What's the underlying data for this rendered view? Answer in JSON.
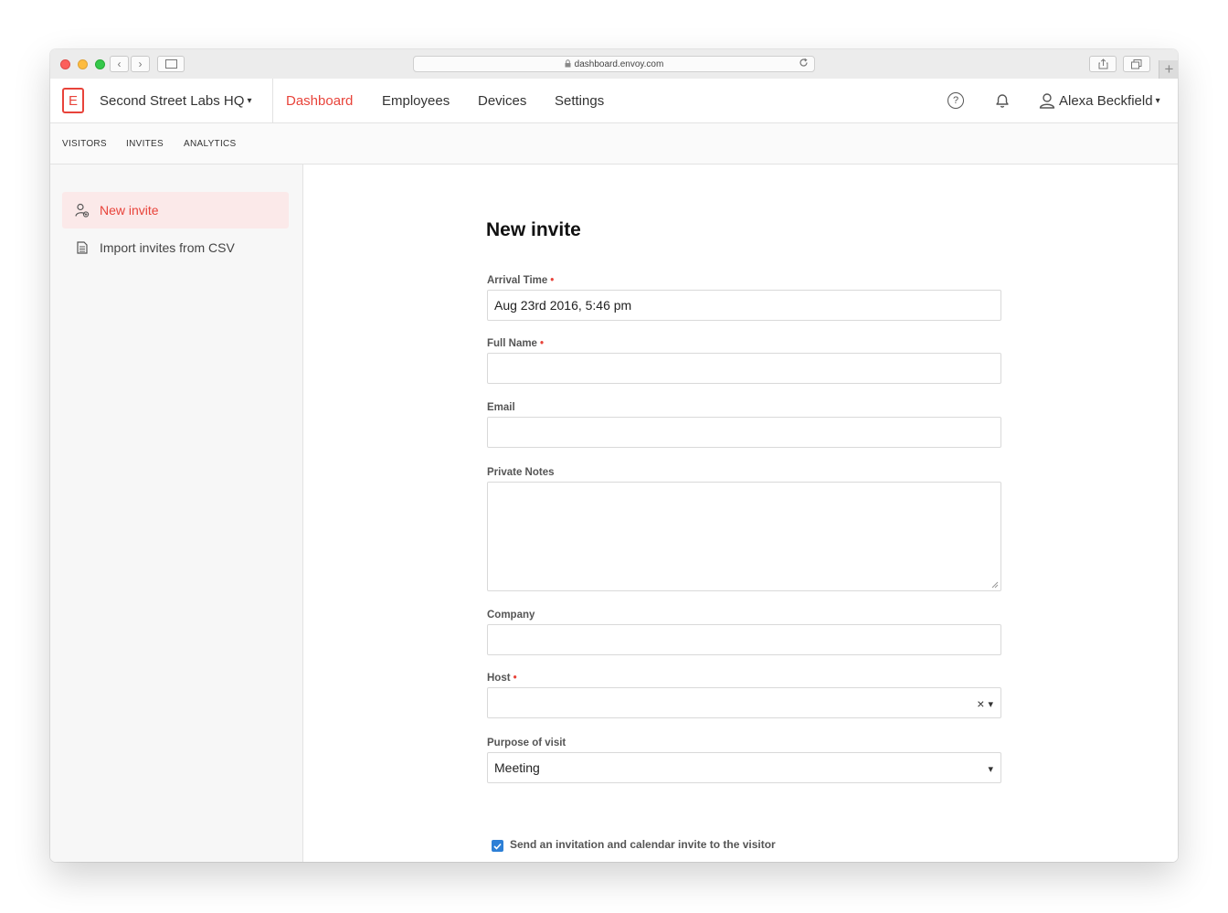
{
  "browser": {
    "url": "dashboard.envoy.com",
    "back_glyph": "‹",
    "forward_glyph": "›",
    "new_tab_glyph": "+"
  },
  "nav": {
    "logo_letter": "E",
    "location": "Second Street Labs HQ",
    "caret": "▾",
    "links": [
      "Dashboard",
      "Employees",
      "Devices",
      "Settings"
    ],
    "active": "Dashboard",
    "help_glyph": "?",
    "user": "Alexa Beckfield",
    "accent_color": "#e8433a"
  },
  "subnav": {
    "links": [
      "VISITORS",
      "INVITES",
      "ANALYTICS"
    ]
  },
  "sidebar": {
    "items": [
      {
        "label": "New invite",
        "icon": "add-person-icon",
        "active": true
      },
      {
        "label": "Import invites from CSV",
        "icon": "document-icon",
        "active": false
      }
    ]
  },
  "form": {
    "title": "New invite",
    "required_marker": "•",
    "fields": {
      "arrival_time": {
        "label": "Arrival Time",
        "value": "Aug 23rd 2016, 5:46 pm"
      },
      "full_name": {
        "label": "Full Name",
        "value": ""
      },
      "email": {
        "label": "Email",
        "value": ""
      },
      "private_notes": {
        "label": "Private Notes",
        "value": ""
      },
      "company": {
        "label": "Company",
        "value": ""
      },
      "host": {
        "label": "Host",
        "value": "",
        "clear_glyph": "×",
        "arrow_glyph": "▾"
      },
      "purpose": {
        "label": "Purpose of visit",
        "value": "Meeting",
        "arrow_glyph": "▾"
      }
    },
    "send_invite": {
      "label": "Send an invitation and calendar invite to the visitor",
      "checked": true
    }
  }
}
